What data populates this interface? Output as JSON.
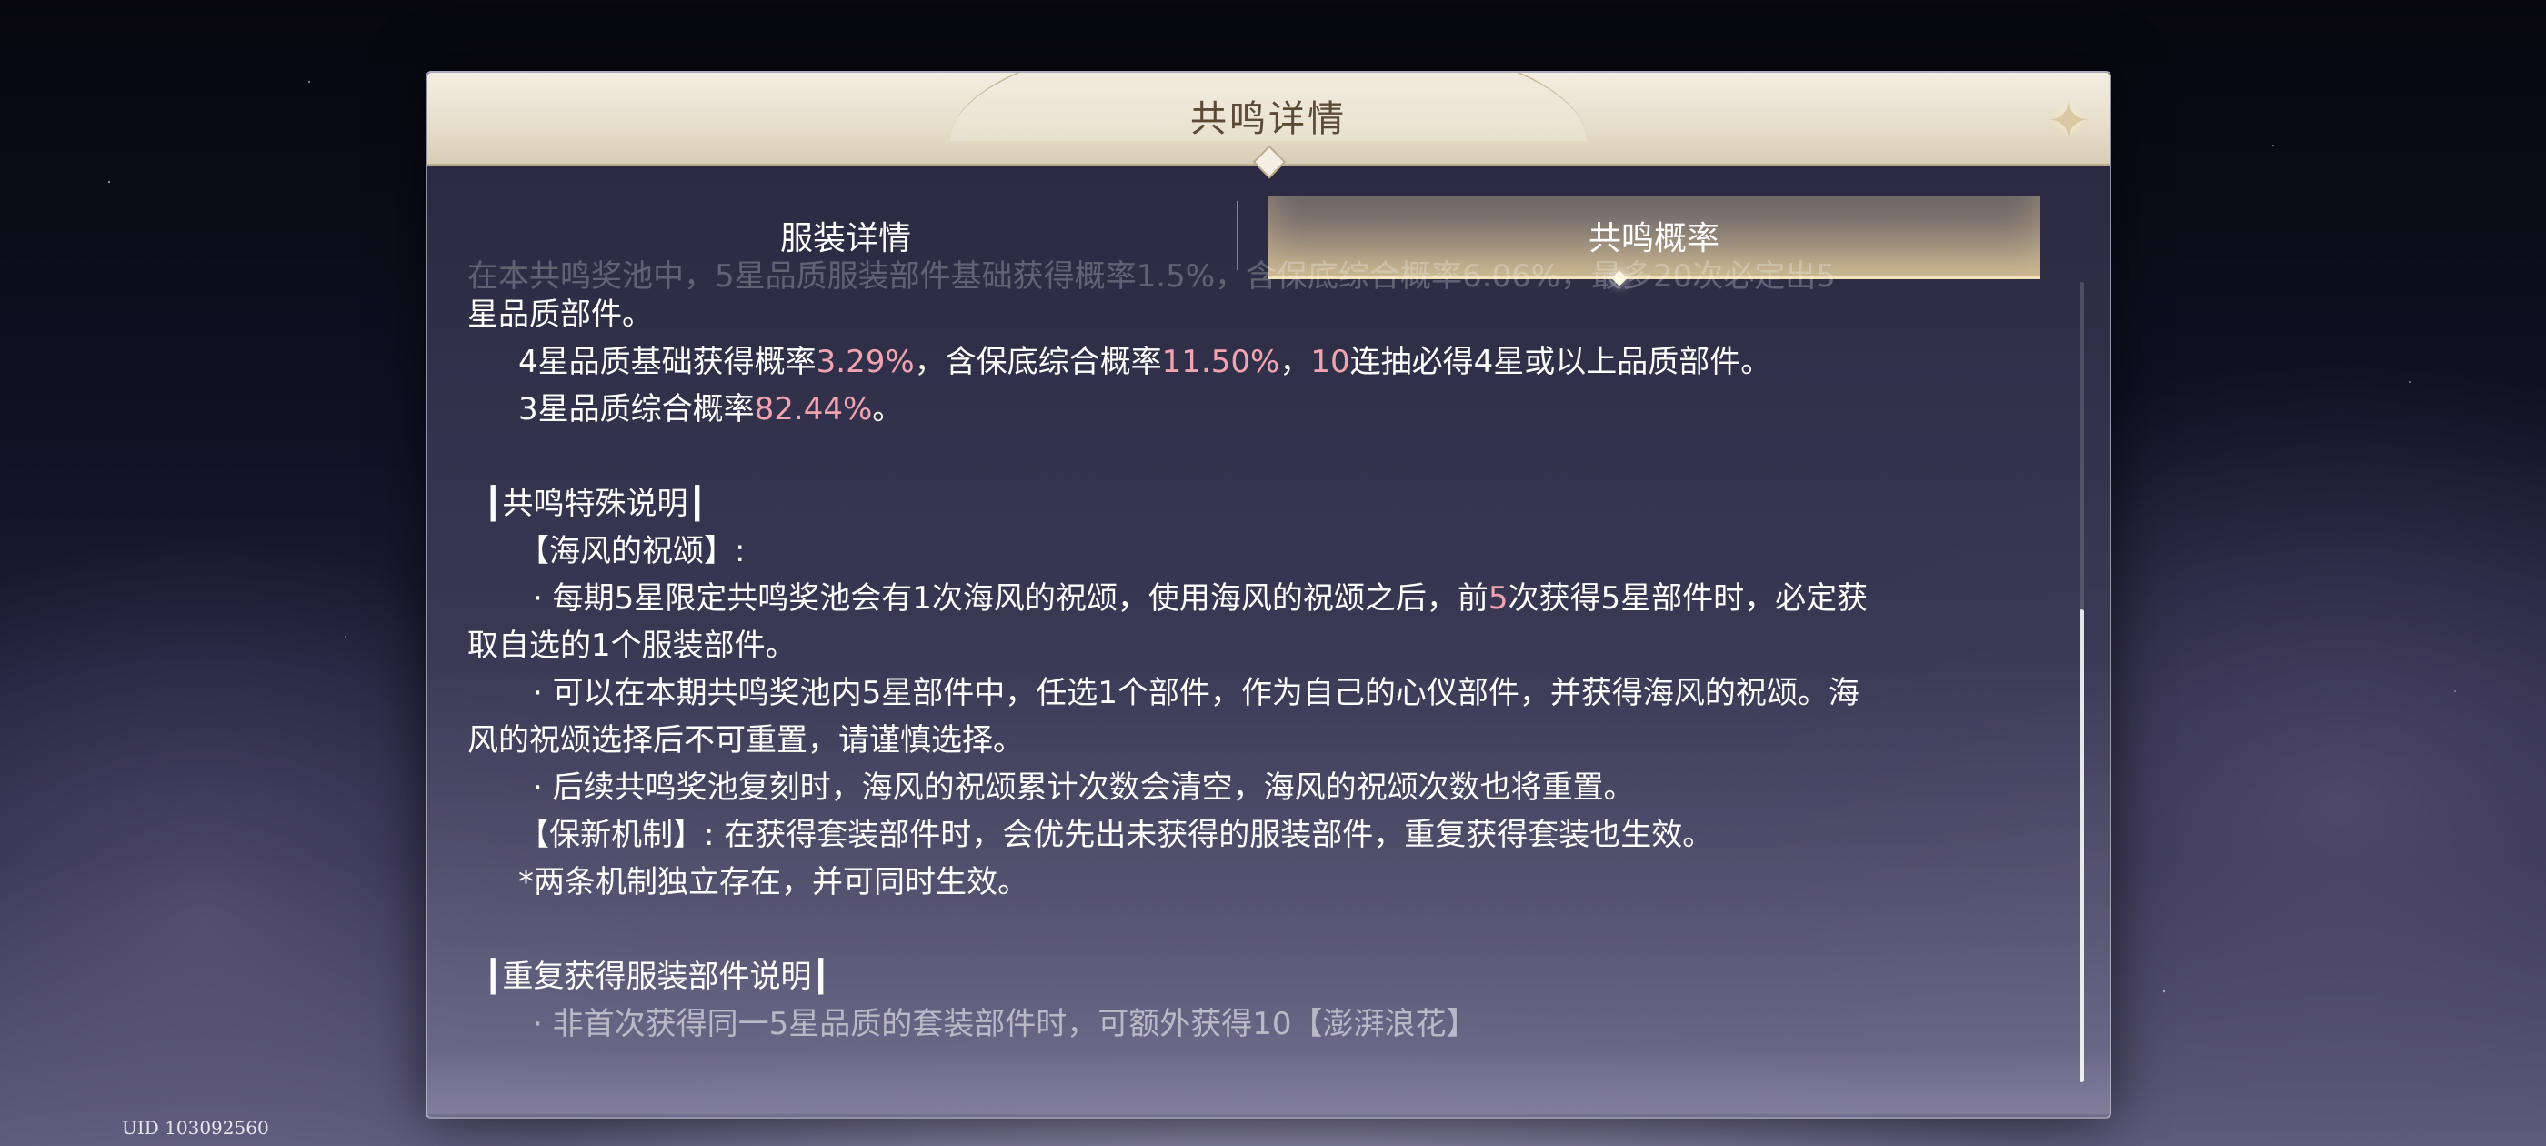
{
  "title": "共鸣详情",
  "close_icon": "sparkle-star-icon",
  "tabs": [
    {
      "label": "服装详情",
      "active": false
    },
    {
      "label": "共鸣概率",
      "active": true
    }
  ],
  "content": {
    "faded_line": "在本共鸣奖池中，5星品质服装部件基础获得概率1.5%，含保底综合概率6.06%，最多20次必定出5",
    "line_5star_end": "星品质部件。",
    "line_4star": {
      "a": "4星品质基础获得概率",
      "b": "3.29%",
      "c": "，含保底综合概率",
      "d": "11.50%",
      "e": "，",
      "f": "10",
      "g": "连抽必得4星或以上品质部件。"
    },
    "line_3star": {
      "a": "3星品质综合概率",
      "b": "82.44%",
      "c": "。"
    },
    "section_special": "┃共鸣特殊说明┃",
    "blessing_title": "【海风的祝颂】:",
    "bullet1": {
      "a": "· 每期5星限定共鸣奖池会有1次海风的祝颂，使用海风的祝颂之后，前",
      "b": "5",
      "c": "次获得5星部件时，必定获",
      "d": "取自选的1个服装部件。"
    },
    "bullet2": {
      "a": "· 可以在本期共鸣奖池内5星部件中，任选1个部件，作为自己的心仪部件，并获得海风的祝颂。海",
      "b": "风的祝颂选择后不可重置，请谨慎选择。"
    },
    "bullet3": "· 后续共鸣奖池复刻时，海风的祝颂累计次数会清空，海风的祝颂次数也将重置。",
    "guarantee": "【保新机制】: 在获得套装部件时，会优先出未获得的服装部件，重复获得套装也生效。",
    "note": "*两条机制独立存在，并可同时生效。",
    "section_repeat": "┃重复获得服装部件说明┃",
    "repeat_partial": "· 非首次获得同一5星品质的套装部件时，可额外获得10【澎湃浪花】"
  },
  "footer": {
    "uid": "UID 103092560"
  },
  "colors": {
    "highlight": "#f0a3b0",
    "text": "#ffffff",
    "title": "#5a4a36"
  }
}
